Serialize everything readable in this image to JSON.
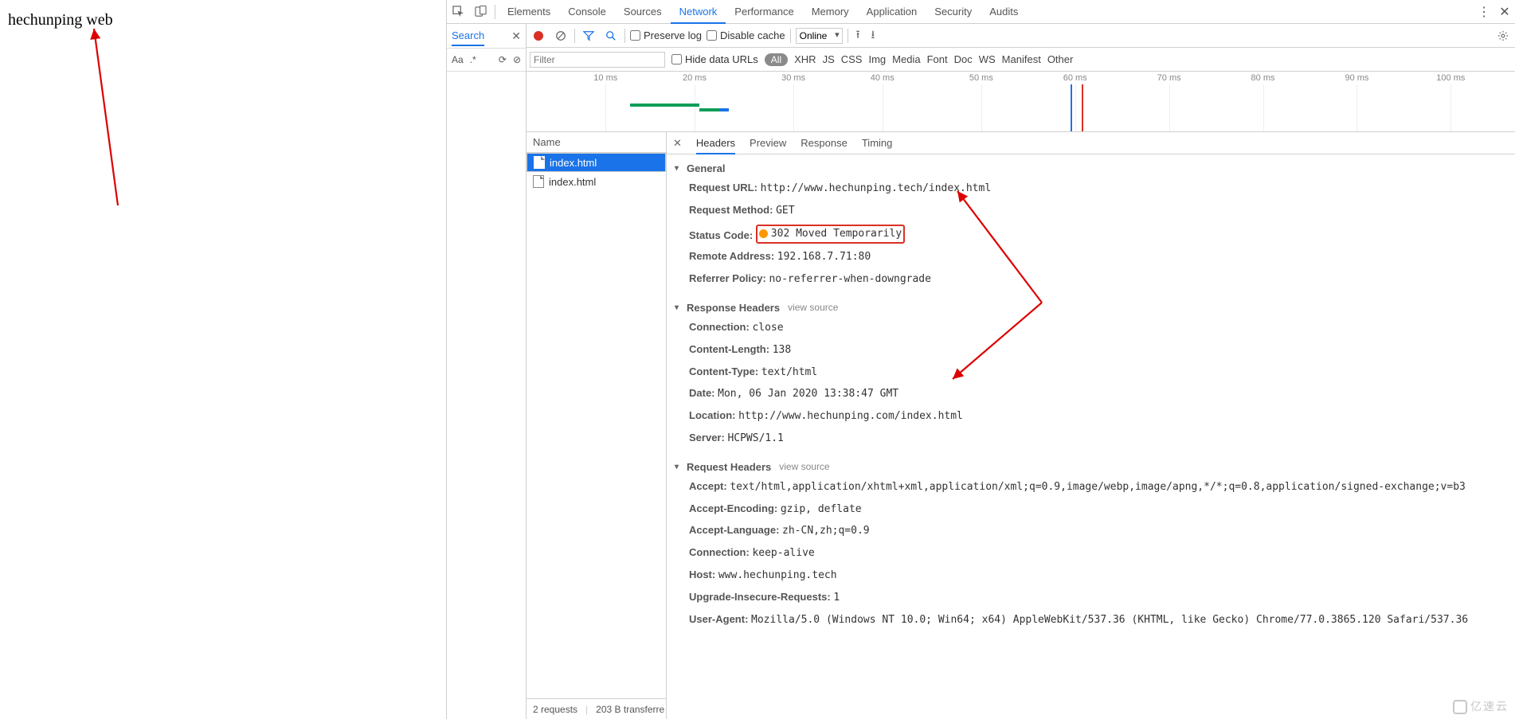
{
  "page_text": "hechunping web",
  "devtools_tabs": [
    "Elements",
    "Console",
    "Sources",
    "Network",
    "Performance",
    "Memory",
    "Application",
    "Security",
    "Audits"
  ],
  "devtools_active_tab": "Network",
  "search_pane": {
    "title": "Search",
    "close": "✕",
    "aa": "Aa",
    "regex": ".*",
    "refresh": "⟳",
    "clear": "⊘"
  },
  "toolbar": {
    "preserve_log": "Preserve log",
    "disable_cache": "Disable cache",
    "throttling": "Online"
  },
  "filter": {
    "placeholder": "Filter",
    "hide_data_urls": "Hide data URLs",
    "all": "All",
    "types": [
      "XHR",
      "JS",
      "CSS",
      "Img",
      "Media",
      "Font",
      "Doc",
      "WS",
      "Manifest",
      "Other"
    ]
  },
  "timeline_ticks": [
    "10 ms",
    "20 ms",
    "30 ms",
    "40 ms",
    "50 ms",
    "60 ms",
    "70 ms",
    "80 ms",
    "90 ms",
    "100 ms"
  ],
  "requests": {
    "header": "Name",
    "items": [
      {
        "name": "index.html",
        "selected": true
      },
      {
        "name": "index.html",
        "selected": false
      }
    ]
  },
  "detail_tabs": [
    "Headers",
    "Preview",
    "Response",
    "Timing"
  ],
  "detail_active": "Headers",
  "general": {
    "title": "General",
    "request_url_k": "Request URL:",
    "request_url_v": "http://www.hechunping.tech/index.html",
    "request_method_k": "Request Method:",
    "request_method_v": "GET",
    "status_code_k": "Status Code:",
    "status_code_v": "302 Moved Temporarily",
    "remote_addr_k": "Remote Address:",
    "remote_addr_v": "192.168.7.71:80",
    "referrer_k": "Referrer Policy:",
    "referrer_v": "no-referrer-when-downgrade"
  },
  "response_headers": {
    "title": "Response Headers",
    "view_source": "view source",
    "items": [
      {
        "k": "Connection:",
        "v": "close"
      },
      {
        "k": "Content-Length:",
        "v": "138"
      },
      {
        "k": "Content-Type:",
        "v": "text/html"
      },
      {
        "k": "Date:",
        "v": "Mon, 06 Jan 2020 13:38:47 GMT"
      },
      {
        "k": "Location:",
        "v": "http://www.hechunping.com/index.html"
      },
      {
        "k": "Server:",
        "v": "HCPWS/1.1"
      }
    ]
  },
  "request_headers": {
    "title": "Request Headers",
    "view_source": "view source",
    "items": [
      {
        "k": "Accept:",
        "v": "text/html,application/xhtml+xml,application/xml;q=0.9,image/webp,image/apng,*/*;q=0.8,application/signed-exchange;v=b3"
      },
      {
        "k": "Accept-Encoding:",
        "v": "gzip, deflate"
      },
      {
        "k": "Accept-Language:",
        "v": "zh-CN,zh;q=0.9"
      },
      {
        "k": "Connection:",
        "v": "keep-alive"
      },
      {
        "k": "Host:",
        "v": "www.hechunping.tech"
      },
      {
        "k": "Upgrade-Insecure-Requests:",
        "v": "1"
      },
      {
        "k": "User-Agent:",
        "v": "Mozilla/5.0 (Windows NT 10.0; Win64; x64) AppleWebKit/537.36 (KHTML, like Gecko) Chrome/77.0.3865.120 Safari/537.36"
      }
    ]
  },
  "footer": {
    "requests": "2 requests",
    "transferred": "203 B transferre"
  },
  "watermark": "亿速云"
}
